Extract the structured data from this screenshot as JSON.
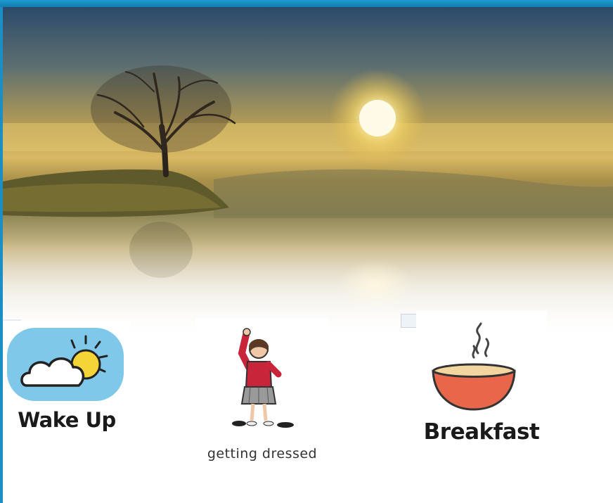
{
  "photo": {
    "scene": "sunrise-over-lake-with-tree"
  },
  "routine": [
    {
      "label": "Wake Up",
      "icon": "sun-cloud-icon"
    },
    {
      "label": "getting dressed",
      "icon": "child-dressing-icon"
    },
    {
      "label": "Breakfast",
      "icon": "steaming-bowl-icon"
    }
  ],
  "colors": {
    "border": "#1b8fc4",
    "sky_wake": "#7fc8ea",
    "sun": "#f5d437",
    "bowl": "#e8674a"
  }
}
